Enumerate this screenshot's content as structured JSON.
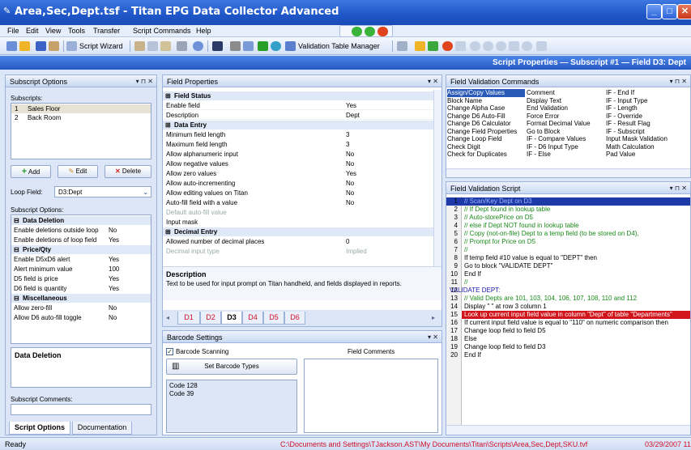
{
  "window": {
    "title": "Area,Sec,Dept.tsf - Titan EPG Data Collector Advanced"
  },
  "menu": [
    "File",
    "Edit",
    "View",
    "Tools",
    "Transfer",
    "Script Commands",
    "Help"
  ],
  "toolbar": {
    "script_wizard": "Script Wizard",
    "validation_manager": "Validation Table Manager"
  },
  "prop_bar": "Script Properties — Subscript #1 — Field D3: Dept",
  "subscript_panel": {
    "title": "Subscript Options",
    "subscripts_label": "Subscripts:",
    "subscripts": [
      {
        "num": "1",
        "name": "Sales Floor"
      },
      {
        "num": "2",
        "name": "Back Room"
      }
    ],
    "add": "Add",
    "edit": "Edit",
    "delete": "Delete",
    "loop_field_label": "Loop Field:",
    "loop_field_value": "D3:Dept",
    "options_label": "Subscript Options:",
    "data_deletion_group": "Data Deletion",
    "dd_rows": [
      {
        "name": "Enable deletions outside loop",
        "value": "No"
      },
      {
        "name": "Enable deletions of loop field",
        "value": "Yes"
      }
    ],
    "price_group": "Price/Qty",
    "pq_rows": [
      {
        "name": "Enable D5xD6 alert",
        "value": "Yes"
      },
      {
        "name": "Alert minimum value",
        "value": "100"
      },
      {
        "name": "D5 field is price",
        "value": "Yes"
      },
      {
        "name": "D6 field is quantity",
        "value": "Yes"
      }
    ],
    "misc_group": "Miscellaneous",
    "misc_rows": [
      {
        "name": "Allow zero-fill",
        "value": "No"
      },
      {
        "name": "Allow D6 auto-fill toggle",
        "value": "No"
      }
    ],
    "desc_title": "Data Deletion",
    "comments_label": "Subscript Comments:",
    "tab_options": "Script Options",
    "tab_documentation": "Documentation"
  },
  "field_panel": {
    "title": "Field Properties",
    "status_group": "Field Status",
    "status_rows": [
      {
        "name": "Enable field",
        "value": "Yes"
      },
      {
        "name": "Description",
        "value": "Dept"
      }
    ],
    "entry_group": "Data Entry",
    "entry_rows": [
      {
        "name": "Minimum field length",
        "value": "3"
      },
      {
        "name": "Maximum field length",
        "value": "3"
      },
      {
        "name": "Allow alphanumeric input",
        "value": "No"
      },
      {
        "name": "Allow negative values",
        "value": "No"
      },
      {
        "name": "Allow zero values",
        "value": "Yes"
      },
      {
        "name": "Allow auto-incrementing",
        "value": "No"
      },
      {
        "name": "Allow editing values on Titan",
        "value": "No"
      },
      {
        "name": "Auto-fill field with a value",
        "value": "No"
      },
      {
        "name": "Default auto-fill value",
        "value": ""
      },
      {
        "name": "Input mask",
        "value": ""
      }
    ],
    "decimal_group": "Decimal Entry",
    "decimal_rows": [
      {
        "name": "Allowed number of decimal places",
        "value": "0"
      },
      {
        "name": "Decimal input type",
        "value": "Implied"
      }
    ],
    "desc_title": "Description",
    "desc_text": "Text to be used for input prompt on Titan handheld, and fields displayed in reports.",
    "tabs": [
      "D1",
      "D2",
      "D3",
      "D4",
      "D5",
      "D6"
    ]
  },
  "barcode_panel": {
    "title": "Barcode Settings",
    "scanning": "Barcode Scanning",
    "comments_label": "Field Comments",
    "set_types": "Set Barcode Types",
    "types": [
      "Code 128",
      "Code 39"
    ]
  },
  "commands_panel": {
    "title": "Field Validation Commands",
    "columns": [
      [
        "Assign/Copy Values",
        "Block Name",
        "Change Alpha Case",
        "Change D6 Auto-Fill",
        "Change D6 Calculator",
        "Change Field Properties",
        "Change Loop Field",
        "Check Digit",
        "Check for Duplicates"
      ],
      [
        "Comment",
        "Display Text",
        "End Validation",
        "Force Error",
        "Format Decimal Value",
        "Go to Block",
        "IF - Compare Values",
        "IF - D6 Input Type",
        "IF - Else"
      ],
      [
        "IF - End If",
        "IF - Input Type",
        "IF - Length",
        "IF - Override",
        "IF - Result Flag",
        "IF - Subscript",
        "Input Mask Validation",
        "Math Calculation",
        "Pad Value"
      ]
    ]
  },
  "script_panel": {
    "title": "Field Validation Script",
    "lines": [
      {
        "n": "1",
        "t": "// Scan/Key Dept on D3"
      },
      {
        "n": "2",
        "t": "//    If Dept found in lookup table"
      },
      {
        "n": "3",
        "t": "//        Auto-storePrice on D5"
      },
      {
        "n": "4",
        "t": "//    else if Dept NOT found in lookup table"
      },
      {
        "n": "5",
        "t": "//        Copy (not-on-file) Dept to a temp field (to be stored on D4),"
      },
      {
        "n": "6",
        "t": "//        Prompt for Price on D5"
      },
      {
        "n": "7",
        "t": "//"
      },
      {
        "n": "8",
        "t": "If temp field #10 value is equal to \"DEPT\" then"
      },
      {
        "n": "9",
        "t": "    Go to block \"VALIDATE DEPT\""
      },
      {
        "n": "10",
        "t": "End If"
      },
      {
        "n": "11",
        "t": "//"
      },
      {
        "n": "12",
        "t": "VALIDATE DEPT:"
      },
      {
        "n": "13",
        "t": "// Valid Depts are 101, 103, 104, 106, 107, 108, 110 and 112"
      },
      {
        "n": "14",
        "t": "Display \" \" at row 3 column 1"
      },
      {
        "n": "15",
        "t": "Look up current input field value in column \"Dept\" of table \"Departments\""
      },
      {
        "n": "16",
        "t": "If current input field value is equal to \"110\" on numeric comparison then"
      },
      {
        "n": "17",
        "t": "    Change loop field to field D5"
      },
      {
        "n": "18",
        "t": "Else"
      },
      {
        "n": "19",
        "t": "    Change loop field to field D3"
      },
      {
        "n": "20",
        "t": "End If"
      }
    ]
  },
  "status": {
    "ready": "Ready",
    "path": "C:\\Documents and Settings\\TJackson.AST\\My Documents\\Titan\\Scripts\\Area,Sec,Dept,SKU.tvf",
    "datetime": "03/29/2007 11:3"
  }
}
